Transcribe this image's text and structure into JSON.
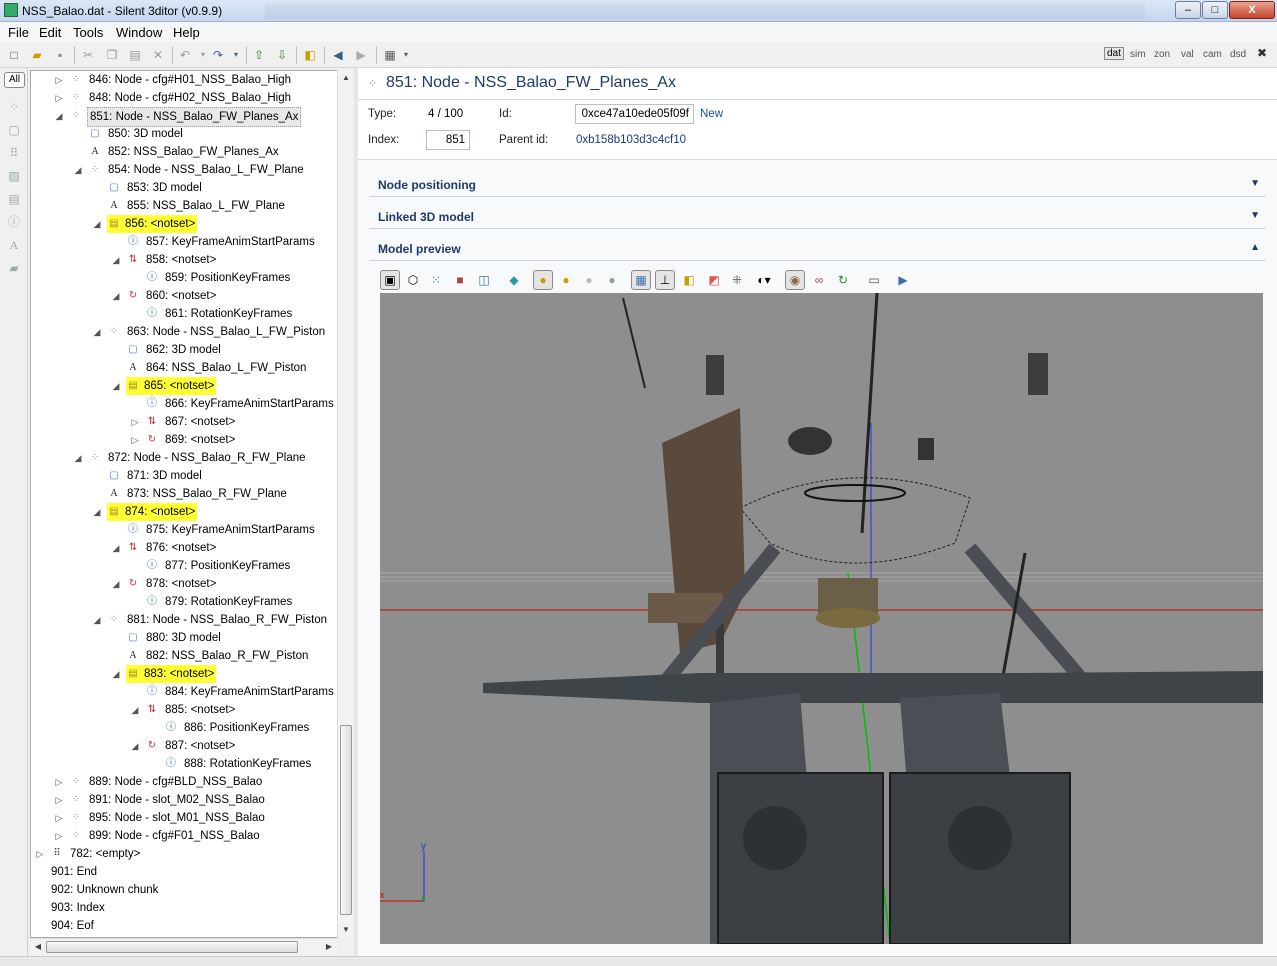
{
  "window": {
    "title": "NSS_Balao.dat - Silent 3ditor (v0.9.9)",
    "min_glyph": "‒",
    "max_glyph": "□",
    "close_glyph": "X"
  },
  "menu": [
    "File",
    "Edit",
    "Tools",
    "Window",
    "Help"
  ],
  "filters": [
    "dat",
    "sim",
    "zon",
    "val",
    "cam",
    "dsd"
  ],
  "filter_close": "✖",
  "rail": {
    "all_label": "All"
  },
  "tree": [
    {
      "label": "846: Node - cfg#H01_NSS_Balao_High",
      "level": 1,
      "expander": "▷",
      "icon": "node-icon",
      "state": ""
    },
    {
      "label": "848: Node - cfg#H02_NSS_Balao_High",
      "level": 1,
      "expander": "▷",
      "icon": "node-icon",
      "state": ""
    },
    {
      "label": "851: Node - NSS_Balao_FW_Planes_Ax",
      "level": 1,
      "expander": "◢",
      "icon": "node-icon",
      "state": "selected"
    },
    {
      "label": "850: 3D model",
      "level": 2,
      "expander": "",
      "icon": "model-icon",
      "state": ""
    },
    {
      "label": "852: NSS_Balao_FW_Planes_Ax",
      "level": 2,
      "expander": "",
      "icon": "text-icon",
      "state": ""
    },
    {
      "label": "854: Node - NSS_Balao_L_FW_Plane",
      "level": 2,
      "expander": "◢",
      "icon": "node-icon",
      "state": ""
    },
    {
      "label": "853: 3D model",
      "level": 3,
      "expander": "",
      "icon": "model-icon",
      "state": ""
    },
    {
      "label": "855: NSS_Balao_L_FW_Plane",
      "level": 3,
      "expander": "",
      "icon": "text-icon",
      "state": ""
    },
    {
      "label": "856: <notset>",
      "level": 3,
      "expander": "◢",
      "icon": "doc-icon",
      "state": "highlighted"
    },
    {
      "label": "857: KeyFrameAnimStartParams",
      "level": 4,
      "expander": "",
      "icon": "info-icon",
      "state": ""
    },
    {
      "label": "858: <notset>",
      "level": 4,
      "expander": "◢",
      "icon": "position-track-icon",
      "state": ""
    },
    {
      "label": "859: PositionKeyFrames",
      "level": 5,
      "expander": "",
      "icon": "info-icon",
      "state": ""
    },
    {
      "label": "860: <notset>",
      "level": 4,
      "expander": "◢",
      "icon": "rotation-track-icon",
      "state": ""
    },
    {
      "label": "861: RotationKeyFrames",
      "level": 5,
      "expander": "",
      "icon": "info-icon",
      "state": ""
    },
    {
      "label": "863: Node - NSS_Balao_L_FW_Piston",
      "level": 3,
      "expander": "◢",
      "icon": "node-icon",
      "state": ""
    },
    {
      "label": "862: 3D model",
      "level": 4,
      "expander": "",
      "icon": "model-icon",
      "state": ""
    },
    {
      "label": "864: NSS_Balao_L_FW_Piston",
      "level": 4,
      "expander": "",
      "icon": "text-icon",
      "state": ""
    },
    {
      "label": "865: <notset>",
      "level": 4,
      "expander": "◢",
      "icon": "doc-icon",
      "state": "highlighted"
    },
    {
      "label": "866: KeyFrameAnimStartParams",
      "level": 5,
      "expander": "",
      "icon": "info-icon",
      "state": ""
    },
    {
      "label": "867: <notset>",
      "level": 5,
      "expander": "▷",
      "icon": "position-track-icon",
      "state": ""
    },
    {
      "label": "869: <notset>",
      "level": 5,
      "expander": "▷",
      "icon": "rotation-track-icon",
      "state": ""
    },
    {
      "label": "872: Node - NSS_Balao_R_FW_Plane",
      "level": 2,
      "expander": "◢",
      "icon": "node-icon",
      "state": ""
    },
    {
      "label": "871: 3D model",
      "level": 3,
      "expander": "",
      "icon": "model-icon",
      "state": ""
    },
    {
      "label": "873: NSS_Balao_R_FW_Plane",
      "level": 3,
      "expander": "",
      "icon": "text-icon",
      "state": ""
    },
    {
      "label": "874: <notset>",
      "level": 3,
      "expander": "◢",
      "icon": "doc-icon",
      "state": "highlighted"
    },
    {
      "label": "875: KeyFrameAnimStartParams",
      "level": 4,
      "expander": "",
      "icon": "info-icon",
      "state": ""
    },
    {
      "label": "876: <notset>",
      "level": 4,
      "expander": "◢",
      "icon": "position-track-icon",
      "state": ""
    },
    {
      "label": "877: PositionKeyFrames",
      "level": 5,
      "expander": "",
      "icon": "info-icon",
      "state": ""
    },
    {
      "label": "878: <notset>",
      "level": 4,
      "expander": "◢",
      "icon": "rotation-track-icon",
      "state": ""
    },
    {
      "label": "879: RotationKeyFrames",
      "level": 5,
      "expander": "",
      "icon": "info-icon",
      "state": ""
    },
    {
      "label": "881: Node - NSS_Balao_R_FW_Piston",
      "level": 3,
      "expander": "◢",
      "icon": "node-icon",
      "state": ""
    },
    {
      "label": "880: 3D model",
      "level": 4,
      "expander": "",
      "icon": "model-icon",
      "state": ""
    },
    {
      "label": "882: NSS_Balao_R_FW_Piston",
      "level": 4,
      "expander": "",
      "icon": "text-icon",
      "state": ""
    },
    {
      "label": "883: <notset>",
      "level": 4,
      "expander": "◢",
      "icon": "doc-icon",
      "state": "highlighted"
    },
    {
      "label": "884: KeyFrameAnimStartParams",
      "level": 5,
      "expander": "",
      "icon": "info-icon",
      "state": ""
    },
    {
      "label": "885: <notset>",
      "level": 5,
      "expander": "◢",
      "icon": "position-track-icon",
      "state": ""
    },
    {
      "label": "886: PositionKeyFrames",
      "level": 6,
      "expander": "",
      "icon": "info-icon",
      "state": ""
    },
    {
      "label": "887: <notset>",
      "level": 5,
      "expander": "◢",
      "icon": "rotation-track-icon",
      "state": ""
    },
    {
      "label": "888: RotationKeyFrames",
      "level": 6,
      "expander": "",
      "icon": "info-icon",
      "state": ""
    },
    {
      "label": "889: Node - cfg#BLD_NSS_Balao",
      "level": 1,
      "expander": "▷",
      "icon": "node-icon",
      "state": ""
    },
    {
      "label": "891: Node - slot_M02_NSS_Balao",
      "level": 1,
      "expander": "▷",
      "icon": "node-icon",
      "state": ""
    },
    {
      "label": "895: Node - slot_M01_NSS_Balao",
      "level": 1,
      "expander": "▷",
      "icon": "node-icon",
      "state": ""
    },
    {
      "label": "899: Node - cfg#F01_NSS_Balao",
      "level": 1,
      "expander": "▷",
      "icon": "node-icon",
      "state": ""
    },
    {
      "label": "782: <empty>",
      "level": 0,
      "expander": "▷",
      "icon": "spheres-icon",
      "state": ""
    },
    {
      "label": "901: End",
      "level": 0,
      "expander": "",
      "icon": "",
      "state": ""
    },
    {
      "label": "902: Unknown chunk",
      "level": 0,
      "expander": "",
      "icon": "",
      "state": ""
    },
    {
      "label": "903: Index",
      "level": 0,
      "expander": "",
      "icon": "",
      "state": ""
    },
    {
      "label": "904: Eof",
      "level": 0,
      "expander": "",
      "icon": "",
      "state": ""
    }
  ],
  "detail": {
    "title": "851: Node - NSS_Balao_FW_Planes_Ax",
    "type_label": "Type:",
    "type_value": "4 / 100",
    "id_label": "Id:",
    "id_value": "0xce47a10ede05f09f",
    "new_link": "New",
    "index_label": "Index:",
    "index_value": "851",
    "parent_label": "Parent id:",
    "parent_value": "0xb158b103d3c4cf10"
  },
  "sections": [
    {
      "title": "Node positioning",
      "chevron": "▼"
    },
    {
      "title": "Linked 3D model",
      "chevron": "▼"
    },
    {
      "title": "Model preview",
      "chevron": "▲"
    }
  ],
  "viewport": {
    "background": "#8e8e8e",
    "axis_labels": {
      "y": "y",
      "z": "z",
      "x": "x"
    },
    "axis_colors": {
      "x": "#d00000",
      "y": "#0010d0",
      "z": "#00b000"
    }
  }
}
